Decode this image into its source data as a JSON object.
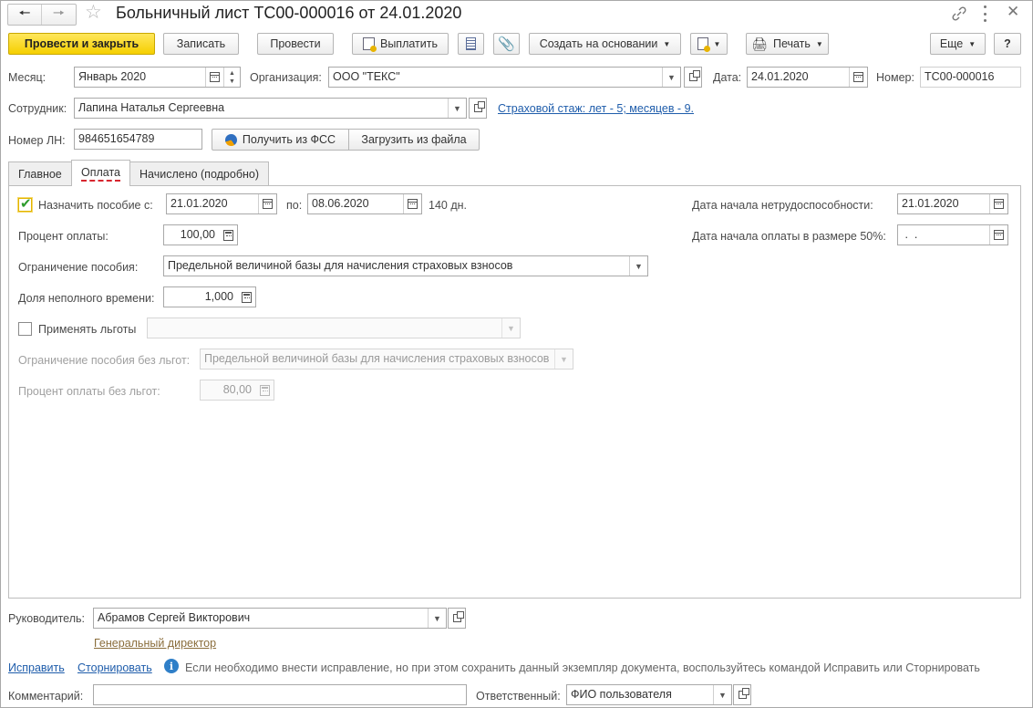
{
  "window": {
    "title": "Больничный лист ТС00-000016 от 24.01.2020"
  },
  "toolbar": {
    "post_close": "Провести и закрыть",
    "save": "Записать",
    "post": "Провести",
    "pay": "Выплатить",
    "create_basis": "Создать на основании",
    "print": "Печать",
    "more": "Еще",
    "help": "?"
  },
  "header": {
    "month_label": "Месяц:",
    "month_value": "Январь 2020",
    "org_label": "Организация:",
    "org_value": "ООО \"ТЕКС\"",
    "date_label": "Дата:",
    "date_value": "24.01.2020",
    "number_label": "Номер:",
    "number_value": "ТС00-000016",
    "employee_label": "Сотрудник:",
    "employee_value": "Лапина Наталья Сергеевна",
    "insurance_link": "Страховой стаж: лет - 5; месяцев - 9.",
    "ln_label": "Номер ЛН:",
    "ln_value": "984651654789",
    "get_fss": "Получить из ФСС",
    "load_file": "Загрузить из файла"
  },
  "tabs": [
    {
      "label": "Главное"
    },
    {
      "label": "Оплата"
    },
    {
      "label": "Начислено (подробно)"
    }
  ],
  "payment": {
    "assign_label": "Назначить пособие с:",
    "assign_checked": true,
    "assign_from": "21.01.2020",
    "to_label": "по:",
    "assign_to": "08.06.2020",
    "days": "140 дн.",
    "incapacity_start_label": "Дата начала нетрудоспособности:",
    "incapacity_start": "21.01.2020",
    "percent_label": "Процент оплаты:",
    "percent_value": "100,00",
    "half_pay_label": "Дата начала оплаты в размере 50%:",
    "half_pay_value": " .  .",
    "limit_label": "Ограничение пособия:",
    "limit_value": "Предельной величиной базы для начисления страховых взносов",
    "part_time_label": "Доля неполного времени:",
    "part_time_value": "1,000",
    "benefits_label": "Применять льготы",
    "benefits_checked": false,
    "limit_nobenefit_label": "Ограничение пособия без льгот:",
    "limit_nobenefit_value": "Предельной величиной базы для начисления страховых взносов",
    "percent_nobenefit_label": "Процент оплаты без льгот:",
    "percent_nobenefit_value": "80,00"
  },
  "footer": {
    "manager_label": "Руководитель:",
    "manager_value": "Абрамов Сергей Викторович",
    "manager_position": "Генеральный директор",
    "fix_link": "Исправить",
    "reverse_link": "Сторнировать",
    "info_text": "Если необходимо внести исправление, но при этом сохранить данный экземпляр документа, воспользуйтесь командой Исправить или Сторнировать",
    "comment_label": "Комментарий:",
    "comment_value": "",
    "responsible_label": "Ответственный:",
    "responsible_value": "ФИО пользователя"
  },
  "colors": {
    "primary_button": "#f5cf00",
    "link": "#1f5dab",
    "position_link": "#8a6d3b",
    "checkbox_accent": "#2e9c2e",
    "info_icon": "#2f7fc8"
  }
}
